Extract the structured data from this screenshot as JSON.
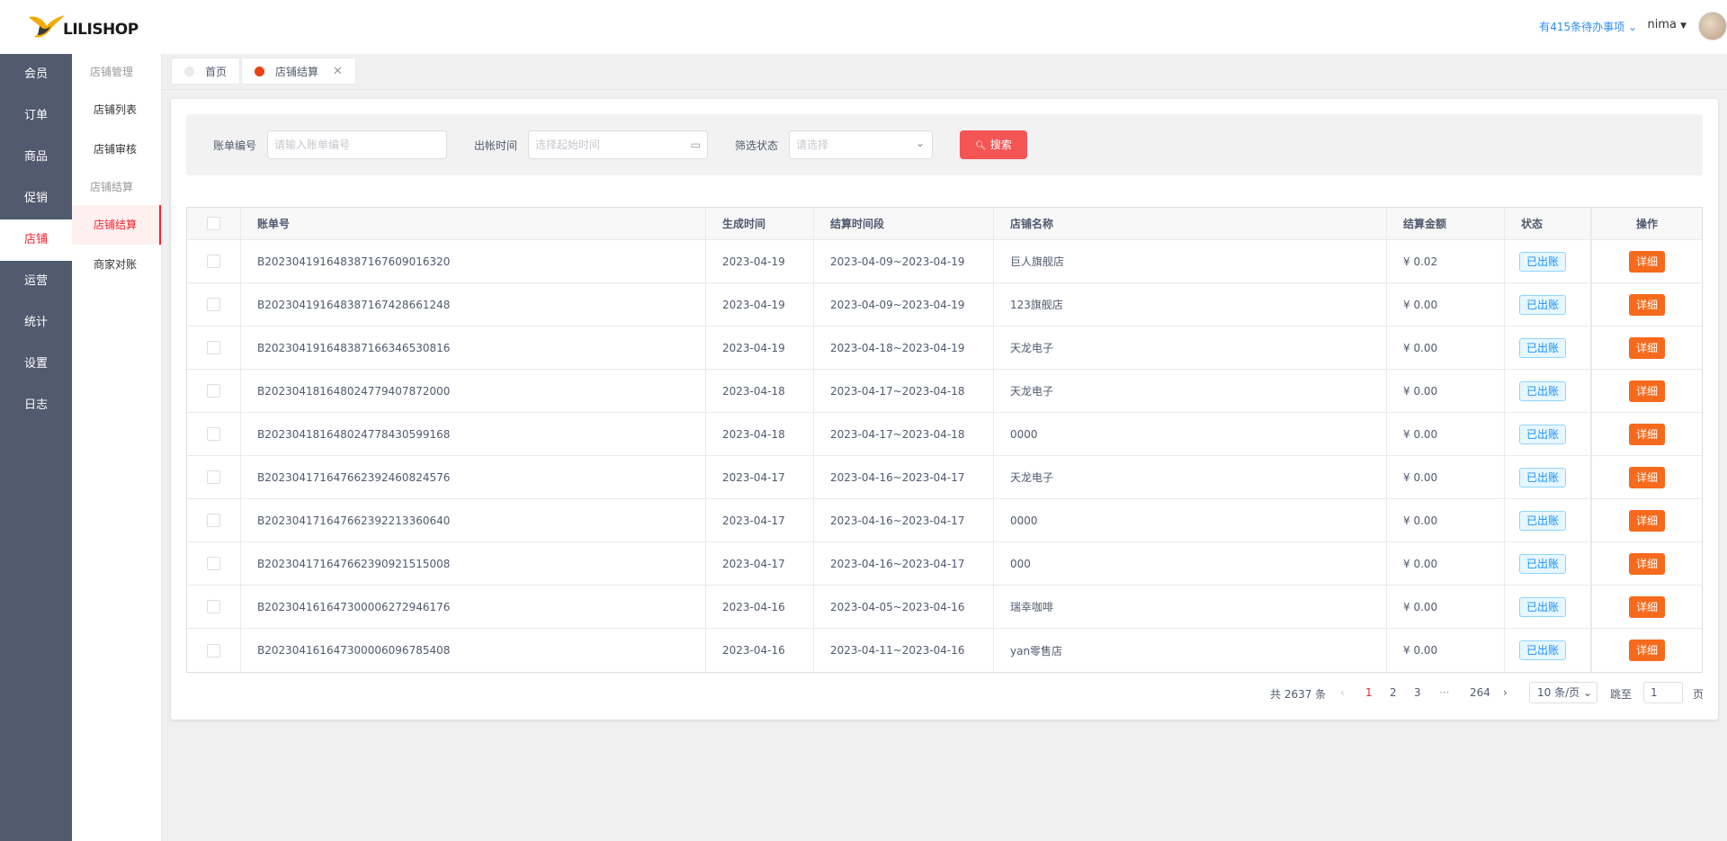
{
  "brand": {
    "name": "LILISHOP"
  },
  "main_nav": [
    {
      "label": "会员"
    },
    {
      "label": "订单"
    },
    {
      "label": "商品"
    },
    {
      "label": "促销"
    },
    {
      "label": "店铺"
    },
    {
      "label": "运营"
    },
    {
      "label": "统计"
    },
    {
      "label": "设置"
    },
    {
      "label": "日志"
    }
  ],
  "sub_nav": {
    "group1": "店铺管理",
    "item1": "店铺列表",
    "item2": "店铺审核",
    "group2": "店铺结算",
    "item3": "店铺结算",
    "item4": "商家对账"
  },
  "header": {
    "todo": "有415条待办事项",
    "user": "nima"
  },
  "tabs": [
    {
      "label": "首页"
    },
    {
      "label": "店铺结算"
    }
  ],
  "filter": {
    "bill_label": "账单编号",
    "bill_placeholder": "请输入账单编号",
    "time_label": "出帐时间",
    "time_placeholder": "选择起始时间",
    "status_label": "筛选状态",
    "status_placeholder": "请选择",
    "search_label": "搜索"
  },
  "table": {
    "headers": [
      "账单号",
      "生成时间",
      "结算时间段",
      "店铺名称",
      "结算金额",
      "状态",
      "操作"
    ],
    "rows": [
      {
        "sn": "B20230419164838716760901632​0",
        "gen": "2023-04-19",
        "period": "2023-04-09~2023-04-19",
        "shop": "巨人旗舰店",
        "amount": "¥ 0.02",
        "status": "已出账",
        "op": "详细"
      },
      {
        "sn": "B202304191648387167428661248",
        "gen": "2023-04-19",
        "period": "2023-04-09~2023-04-19",
        "shop": "123旗舰店",
        "amount": "¥ 0.00",
        "status": "已出账",
        "op": "详细"
      },
      {
        "sn": "B202304191648387166346530816",
        "gen": "2023-04-19",
        "period": "2023-04-18~2023-04-19",
        "shop": "天龙电子",
        "amount": "¥ 0.00",
        "status": "已出账",
        "op": "详细"
      },
      {
        "sn": "B202304181648024779407872000",
        "gen": "2023-04-18",
        "period": "2023-04-17~2023-04-18",
        "shop": "天龙电子",
        "amount": "¥ 0.00",
        "status": "已出账",
        "op": "详细"
      },
      {
        "sn": "B202304181648024778430599168",
        "gen": "2023-04-18",
        "period": "2023-04-17~2023-04-18",
        "shop": "0000",
        "amount": "¥ 0.00",
        "status": "已出账",
        "op": "详细"
      },
      {
        "sn": "B202304171647662392460824576",
        "gen": "2023-04-17",
        "period": "2023-04-16~2023-04-17",
        "shop": "天龙电子",
        "amount": "¥ 0.00",
        "status": "已出账",
        "op": "详细"
      },
      {
        "sn": "B202304171647662392213360640",
        "gen": "2023-04-17",
        "period": "2023-04-16~2023-04-17",
        "shop": "0000",
        "amount": "¥ 0.00",
        "status": "已出账",
        "op": "详细"
      },
      {
        "sn": "B202304171647662390921515008",
        "gen": "2023-04-17",
        "period": "2023-04-16~2023-04-17",
        "shop": "000",
        "amount": "¥ 0.00",
        "status": "已出账",
        "op": "详细"
      },
      {
        "sn": "B202304161647300006272946176",
        "gen": "2023-04-16",
        "period": "2023-04-05~2023-04-16",
        "shop": "瑞幸咖啡",
        "amount": "¥ 0.00",
        "status": "已出账",
        "op": "详细"
      },
      {
        "sn": "B202304161647300006096785408",
        "gen": "2023-04-16",
        "period": "2023-04-11~2023-04-16",
        "shop": "yan零售店",
        "amount": "¥ 0.00",
        "status": "已出账",
        "op": "详细"
      }
    ]
  },
  "pagination": {
    "total": "共 2637 条",
    "pages": [
      "1",
      "2",
      "3",
      "···",
      "264"
    ],
    "page_size": "10 条/页",
    "jump_label": "跳至",
    "jump_value": "1",
    "page_unit": "页"
  },
  "colors": {
    "accent": "#f5222d",
    "sidebar": "#515a6e",
    "link": "#2d8cf0",
    "detail_button": "#f56a1c"
  }
}
